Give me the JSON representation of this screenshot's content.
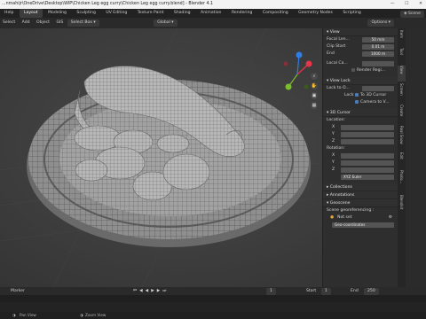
{
  "window": {
    "title": "...nmahijr\\OneDrive\\Desktop\\WIP\\Chicken Leg egg curry\\Chicken Leg egg curry.blend] - Blender 4.1",
    "controls": [
      "—",
      "☐",
      "✕"
    ]
  },
  "topbar": {
    "workspaces": [
      "Help",
      "Layout",
      "Modeling",
      "Sculpting",
      "UV Editing",
      "Texture Paint",
      "Shading",
      "Animation",
      "Rendering",
      "Compositing",
      "Geometry Nodes",
      "Scripting"
    ],
    "active_workspace": "Layout",
    "scene_label": "Scene"
  },
  "header": {
    "menus": [
      "Select",
      "Add",
      "Object",
      "GIS"
    ],
    "select_box": "Select Box",
    "transform": "Global",
    "options": "Options"
  },
  "npanel": {
    "view_section": "View",
    "focal_length_label": "Focal Len...",
    "focal_length_value": "50 mm",
    "clip_start_label": "Clip Start",
    "clip_start_value": "0.01 m",
    "clip_end_label": "End",
    "clip_end_value": "1000 m",
    "local_camera_label": "Local Ca...",
    "render_region_label": "Render Regi...",
    "view_lock_section": "View Lock",
    "lock_to_object_label": "Lock to O...",
    "lock_label": "Lock",
    "to_3d_cursor": "To 3D Cursor",
    "camera_to_view": "Camera to V...",
    "cursor_section": "3D Cursor",
    "location_label": "Location:",
    "rotation_label": "Rotation:",
    "axes": [
      "X",
      "Y",
      "Z"
    ],
    "xyz_euler": "XYZ Euler",
    "collections": "Collections",
    "annotations": "Annotations",
    "geoscene_section": "Geoscene",
    "scene_georef_label": "Scene georeferencing :",
    "crs_not_set": "Not set",
    "geo_coordinates": "Geo-coordinates"
  },
  "vtabs": [
    "Item",
    "Tool",
    "View",
    "Screen",
    "Create",
    "Real Snow",
    "Edit",
    "Photo...",
    "Blendkit"
  ],
  "timeline": {
    "menu": "Marker",
    "frame_current": "1",
    "start_label": "Start",
    "start_value": "1",
    "end_label": "End",
    "end_value": "250"
  },
  "statusbar": {
    "left": "Pan View",
    "mid": "Zoom View"
  },
  "colors": {
    "x_axis": "#e5364a",
    "y_axis": "#7bbd2a",
    "z_axis": "#2f7ee6",
    "accent": "#4a7ab8"
  }
}
